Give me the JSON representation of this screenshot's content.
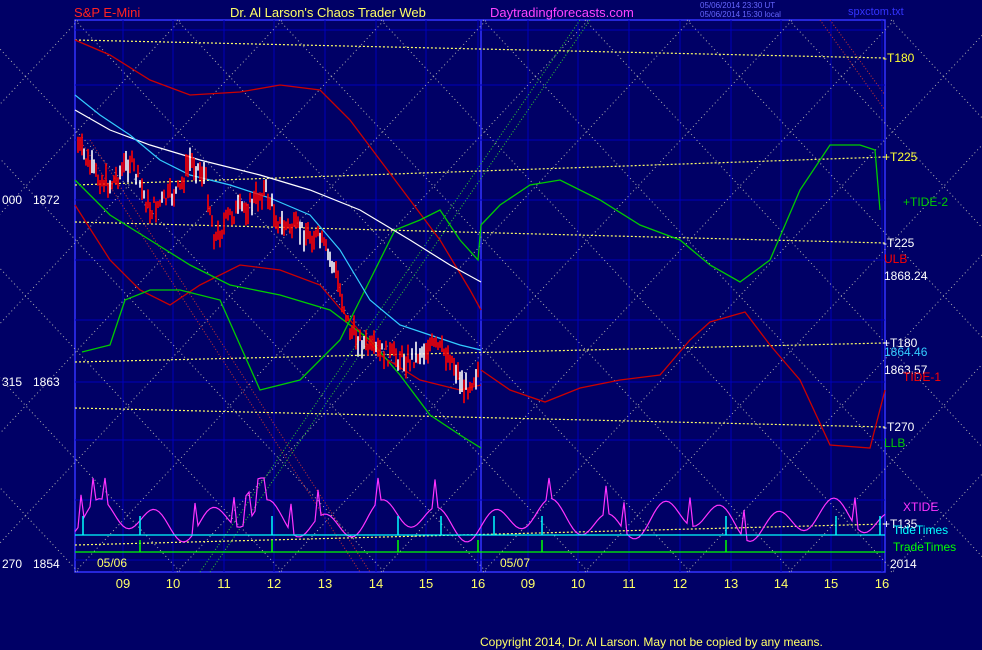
{
  "header": {
    "instrument": "S&P E-Mini",
    "site_title": "Dr. Al Larson's Chaos Trader Web",
    "website": "Daytradingforecasts.com",
    "timestamp_ut": "05/06/2014 23:30 UT",
    "timestamp_local": "05/06/2014 15:30 local",
    "filename": "spxctom.txt"
  },
  "footer": {
    "copyright": "Copyright 2014, Dr. Al Larson. May not be copied by any means."
  },
  "colors": {
    "background": "#000066",
    "plot_border": "#3333ff",
    "grid": "#0000cc",
    "price_up": "#ffffff",
    "price_down": "#ff0000",
    "moving_avg_long": "#ffffff",
    "moving_avg_short": "#33ccff",
    "ulb": "#cc0000",
    "lbb": "#00cc00",
    "tide1": "#cc0000",
    "tide2": "#00cc00",
    "xtide": "#ff33ff",
    "tide_times": "#00ffff",
    "trade_times": "#00ff00",
    "tunnel": "#ffff66",
    "fan": "#c0c0c0"
  },
  "chart_data": {
    "type": "line",
    "title": "S&P E-Mini",
    "x_labels": [
      "09",
      "10",
      "11",
      "12",
      "13",
      "14",
      "15",
      "16",
      "09",
      "10",
      "11",
      "12",
      "13",
      "14",
      "15",
      "16"
    ],
    "date_labels": [
      "05/06",
      "05/07"
    ],
    "year_label": "2014",
    "y_ticks": [
      {
        "left": "000",
        "value": 1872
      },
      {
        "left": "315",
        "value": 1863
      },
      {
        "left": "270",
        "value": 1854
      }
    ],
    "ylim": [
      1854,
      1876.5
    ],
    "series": [
      {
        "name": "XTIDE",
        "color": "#ff33ff"
      },
      {
        "name": "TideTimes",
        "color": "#00ffff"
      },
      {
        "name": "TradeTimes",
        "color": "#00ff00"
      },
      {
        "name": "+TIDE-2",
        "color": "#00cc00"
      },
      {
        "name": "TIDE-1",
        "color": "#cc0000"
      },
      {
        "name": "ULB",
        "color": "#cc0000"
      },
      {
        "name": "LLB",
        "color": "#00cc00"
      }
    ],
    "tunnel_labels": [
      {
        "label": "-T180",
        "color": "#ffff33"
      },
      {
        "label": "+T225",
        "color": "#ffff33"
      },
      {
        "label": "-T225",
        "color": "#ffffff"
      },
      {
        "label": "+T180",
        "color": "#ffffff"
      },
      {
        "label": "-T270",
        "color": "#ffffff"
      },
      {
        "label": "+T135",
        "color": "#ffffff"
      }
    ],
    "right_labels": [
      {
        "label": "+TIDE-2",
        "color": "#00cc00"
      },
      {
        "label": "ULB",
        "color": "#ff0000"
      },
      {
        "label": "1868.24",
        "color": "#ffffff"
      },
      {
        "label": "1864.46",
        "color": "#33ccff"
      },
      {
        "label": "1863.57",
        "color": "#ffffff"
      },
      {
        "label": "TIDE-1",
        "color": "#ff0000"
      },
      {
        "label": "LLB",
        "color": "#00cc00"
      },
      {
        "label": "XTIDE",
        "color": "#ff33ff"
      },
      {
        "label": "TideTimes",
        "color": "#00ffff"
      },
      {
        "label": "TradeTimes",
        "color": "#00ff00"
      }
    ]
  }
}
